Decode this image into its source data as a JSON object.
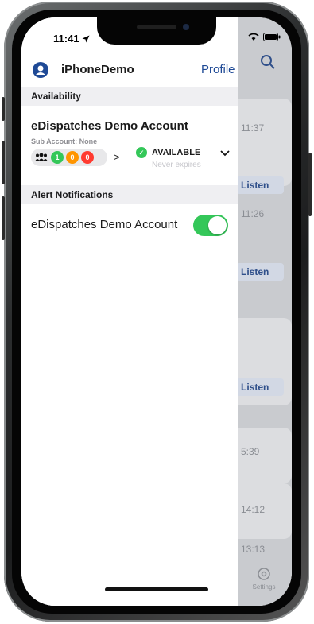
{
  "status": {
    "time": "11:41"
  },
  "header": {
    "username": "iPhoneDemo",
    "profile_label": "Profile"
  },
  "availability": {
    "section_label": "Availability",
    "account_name": "eDispatches Demo Account",
    "sub_account": "Sub Account: None",
    "counts": [
      {
        "value": "1",
        "color": "#34c759"
      },
      {
        "value": "0",
        "color": "#ff9500"
      },
      {
        "value": "0",
        "color": "#ff3b30"
      }
    ],
    "status_label": "AVAILABLE",
    "expiry": "Never expires"
  },
  "alerts": {
    "section_label": "Alert Notifications",
    "account_name": "eDispatches Demo Account",
    "enabled": true
  },
  "background": {
    "times": [
      "11:37",
      "11:26",
      "5:39",
      "14:12",
      "13:13"
    ],
    "listen_label": "Listen",
    "tab_settings": "Settings"
  },
  "colors": {
    "accent": "#1f4a96",
    "available": "#34c759"
  }
}
